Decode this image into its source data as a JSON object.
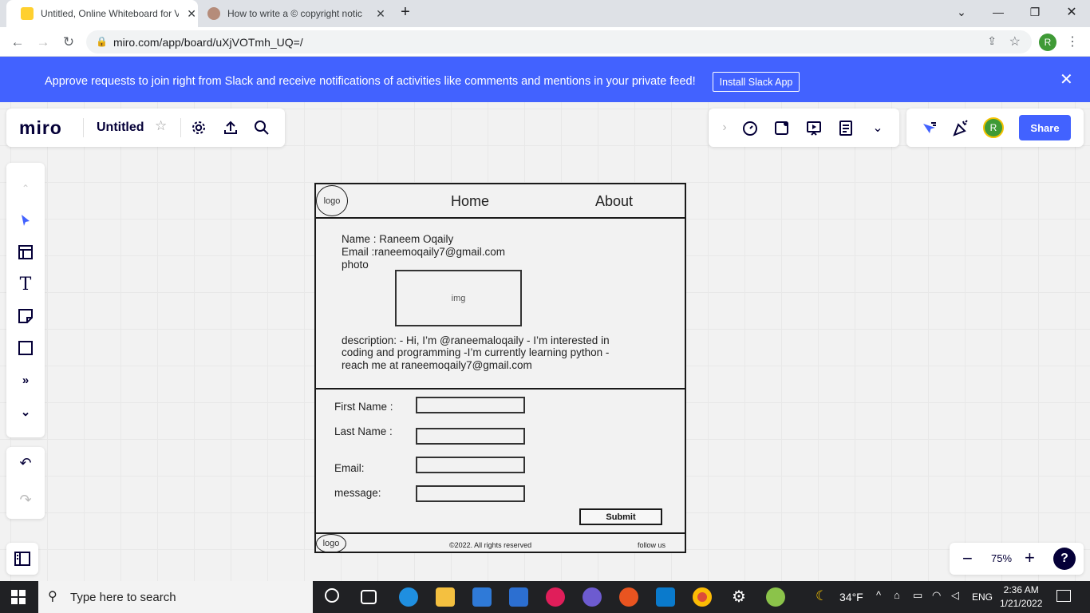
{
  "browser": {
    "tabs": [
      {
        "title": "Untitled, Online Whiteboard for V",
        "active": true
      },
      {
        "title": "How to write a © copyright notic",
        "active": false
      }
    ],
    "url": "miro.com/app/board/uXjVOTmh_UQ=/",
    "profile_initial": "R"
  },
  "banner": {
    "text": "Approve requests to join right from Slack and receive notifications of activities like comments and mentions in your private feed!",
    "button": "Install Slack App"
  },
  "miro": {
    "logo": "miro",
    "board_title": "Untitled",
    "share_label": "Share",
    "avatar_initial": "R",
    "zoom": "75%"
  },
  "wireframe": {
    "header": {
      "logo": "logo",
      "nav": [
        "Home",
        "About"
      ]
    },
    "profile": {
      "name_line": "Name : Raneem Oqaily",
      "email_line": "Email  :raneemoqaily7@gmail.com",
      "photo_label": "photo",
      "img_label": "img",
      "description_lines": [
        "description: -  Hi, I’m @raneemaloqaily -  I’m interested in",
        "coding and programming -I’m currently learning python -",
        "reach me at raneemoqaily7@gmail.com"
      ]
    },
    "form": {
      "labels": [
        "First Name :",
        "Last Name :",
        "Email:",
        "message:"
      ],
      "submit": "Submit"
    },
    "footer": {
      "logo": "logo",
      "copyright": "©2022. All rights reserved",
      "follow": "follow us"
    }
  },
  "taskbar": {
    "search_placeholder": "Type here to search",
    "weather": "34°F",
    "lang": "ENG",
    "time": "2:36 AM",
    "date": "1/21/2022"
  },
  "colors": {
    "brand": "#4262ff",
    "miro_dark": "#050038",
    "canvas": "#f2f2f2"
  }
}
